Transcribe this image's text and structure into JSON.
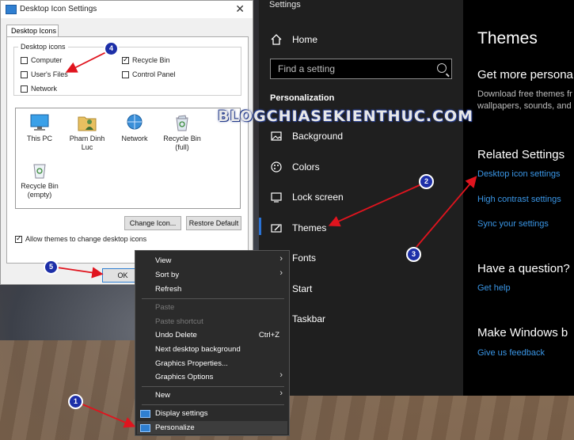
{
  "dialog": {
    "title": "Desktop Icon Settings",
    "tab": "Desktop Icons",
    "group_label": "Desktop icons",
    "checkboxes": [
      {
        "label": "Computer",
        "checked": false
      },
      {
        "label": "User's Files",
        "checked": false
      },
      {
        "label": "Network",
        "checked": false
      },
      {
        "label": "Recycle Bin",
        "checked": true
      },
      {
        "label": "Control Panel",
        "checked": false
      }
    ],
    "icons": [
      {
        "label": "This PC",
        "icon": "monitor-icon"
      },
      {
        "label": "Pham Dinh Luc",
        "icon": "user-folder-icon"
      },
      {
        "label": "Network",
        "icon": "network-icon"
      },
      {
        "label": "Recycle Bin (full)",
        "icon": "recycle-bin-full-icon"
      },
      {
        "label": "Recycle Bin (empty)",
        "icon": "recycle-bin-empty-icon"
      }
    ],
    "change_icon": "Change Icon...",
    "restore_default": "Restore Default",
    "allow_themes": "Allow themes to change desktop icons",
    "allow_themes_checked": true,
    "ok": "OK",
    "close": "✕"
  },
  "settings": {
    "title": "Settings",
    "home": "Home",
    "search_placeholder": "Find a setting",
    "section": "Personalization",
    "nav": [
      "Background",
      "Colors",
      "Lock screen",
      "Themes",
      "Fonts",
      "Start",
      "Taskbar"
    ],
    "active": "Themes",
    "content": {
      "heading": "Themes",
      "get_more": "Get more persona",
      "get_more_desc_1": "Download free themes fr",
      "get_more_desc_2": "wallpapers, sounds, and",
      "related": "Related Settings",
      "link_desktop_icons": "Desktop icon settings",
      "link_high_contrast": "High contrast settings",
      "link_sync": "Sync your settings",
      "question": "Have a question?",
      "get_help": "Get help",
      "make_better": "Make Windows b",
      "feedback": "Give us feedback"
    }
  },
  "context_menu": {
    "view": "View",
    "sort_by": "Sort by",
    "refresh": "Refresh",
    "paste": "Paste",
    "paste_shortcut": "Paste shortcut",
    "undo_delete": "Undo Delete",
    "undo_shortcut": "Ctrl+Z",
    "next_background": "Next desktop background",
    "graphics_properties": "Graphics Properties...",
    "graphics_options": "Graphics Options",
    "new": "New",
    "display_settings": "Display settings",
    "personalize": "Personalize"
  },
  "watermark": "BLOGCHIASEKIENTHUC.COM",
  "markers": [
    "1",
    "2",
    "3",
    "4",
    "5"
  ],
  "colors": {
    "accent": "#2a73d6",
    "link": "#3a96e6",
    "marker": "#1d2fa8",
    "arrow": "#e0141e"
  }
}
